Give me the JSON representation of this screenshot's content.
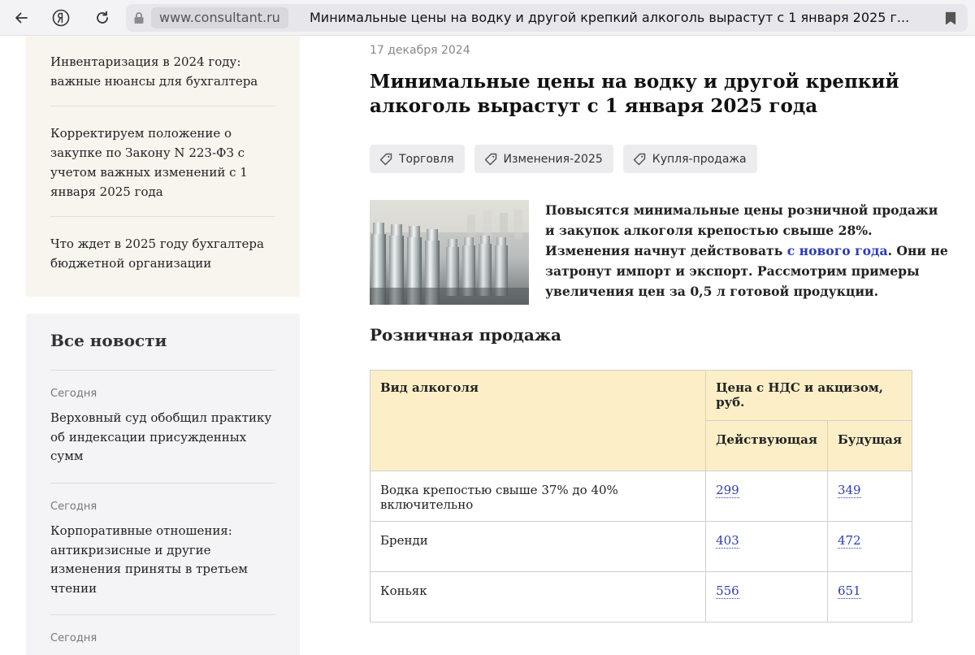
{
  "browser": {
    "domain": "www.consultant.ru",
    "page_title": "Минимальные цены на водку и другой крепкий алкоголь вырастут с 1 января 2025 г..."
  },
  "related": [
    {
      "title": "Инвентаризация в 2024 году: важные нюансы для бухгалтера"
    },
    {
      "title": "Корректируем положение о закупке по Закону N 223-ФЗ с учетом важных изменений с 1 января 2025 года"
    },
    {
      "title": "Что ждет в 2025 году бухгалтера бюджетной организации"
    }
  ],
  "news": {
    "heading": "Все новости",
    "items": [
      {
        "date": "Сегодня",
        "title": "Верховный суд обобщил практику об индексации присужденных сумм"
      },
      {
        "date": "Сегодня",
        "title": "Корпоративные отношения: антикризисные и другие изменения приняты в третьем чтении"
      },
      {
        "date": "Сегодня",
        "title": ""
      }
    ]
  },
  "article": {
    "date": "17 декабря 2024",
    "title": "Минимальные цены на водку и другой крепкий алкоголь вырастут с 1 января 2025 года",
    "tags": [
      "Торговля",
      "Изменения-2025",
      "Купля-продажа"
    ],
    "lead_part1": "Повысятся минимальные цены розничной продажи и закупок алкоголя крепостью свыше 28%.",
    "lead_part2": "Изменения начнут действовать ",
    "lead_link": "с нового года",
    "lead_part3": ". Они не затронут импорт и экспорт. Рассмотрим примеры увеличения цен за 0,5 л готовой продукции.",
    "section_heading": "Розничная продажа"
  },
  "price_table": {
    "col_type": "Вид алкоголя",
    "col_price": "Цена с НДС и акцизом, руб.",
    "col_current": "Действующая",
    "col_future": "Будущая",
    "rows": [
      {
        "type": "Водка крепостью свыше 37% до 40% включительно",
        "current": "299",
        "future": "349"
      },
      {
        "type": "Бренди",
        "current": "403",
        "future": "472"
      },
      {
        "type": "Коньяк",
        "current": "556",
        "future": "651"
      }
    ]
  },
  "colors": {
    "accent_link": "#2c3bb8",
    "table_header_bg": "#fcefc7",
    "related_bg": "#f8f5ee",
    "news_bg": "#f4f4f6"
  },
  "icons": [
    "back-arrow-icon",
    "yandex-logo-icon",
    "reload-icon",
    "lock-icon",
    "bookmark-icon",
    "tag-icon"
  ]
}
